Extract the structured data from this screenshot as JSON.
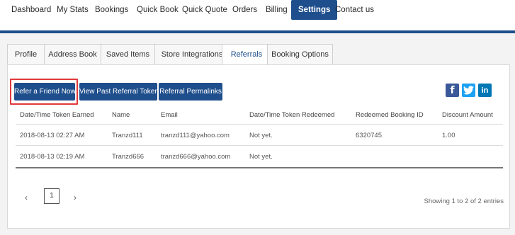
{
  "topnav": {
    "items": [
      "Dashboard",
      "My Stats",
      "Bookings",
      "Quick Book",
      "Quick Quote",
      "Orders",
      "Billing",
      "Settings",
      "Contact us"
    ],
    "active": "Settings"
  },
  "tabs": [
    "Profile",
    "Address Book",
    "Saved Items",
    "Store Integrations",
    "Referrals",
    "Booking Options"
  ],
  "active_tab": "Referrals",
  "buttons": {
    "refer": "Refer a Friend Now",
    "past_tokens": "View Past Referral Tokens",
    "permalinks": "Referral Permalinks"
  },
  "social": {
    "facebook": "f",
    "twitter": "t",
    "linkedin": "in"
  },
  "table": {
    "headers": [
      "Date/Time Token Earned",
      "Name",
      "Email",
      "Date/Time Token Redeemed",
      "Redeemed Booking ID",
      "Discount Amount"
    ],
    "rows": [
      [
        "2018-08-13 02:27 AM",
        "Tranzd111",
        "tranzd111@yahoo.com",
        "Not yet.",
        "6320745",
        "1.00"
      ],
      [
        "2018-08-13 02:19 AM",
        "Tranzd666",
        "tranzd666@yahoo.com",
        "Not yet.",
        "",
        ""
      ]
    ]
  },
  "pagination": {
    "prev": "‹",
    "page": "1",
    "next": "›",
    "summary": "Showing 1 to 2 of 2 entries"
  },
  "colors": {
    "brand": "#1f4e8c",
    "highlight": "#e0393b",
    "facebook": "#3b5998",
    "twitter": "#1da1f2",
    "linkedin": "#0077b5"
  }
}
